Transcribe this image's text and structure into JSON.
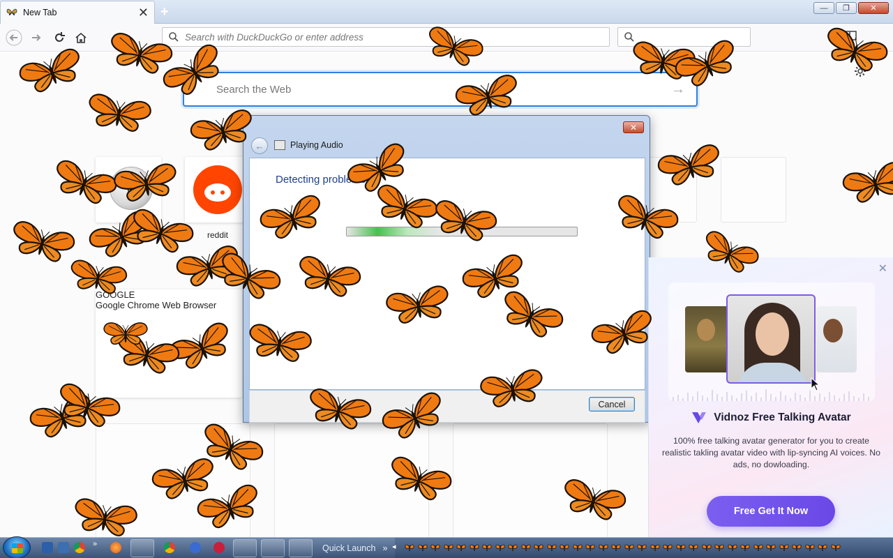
{
  "browser": {
    "tab_title": "New Tab",
    "tab_close": "✕",
    "new_tab": "+",
    "window_buttons": {
      "minimize": "—",
      "maximize": "❐",
      "close": "✕"
    },
    "url_placeholder": "Search with DuckDuckGo or enter address",
    "search_placeholder": ""
  },
  "newtab": {
    "search_placeholder": "Search the Web",
    "search_arrow": "→",
    "settings_icon": "gear-icon",
    "tiles": [
      {
        "label": "",
        "icon": "wikipedia-icon",
        "logo_text": "W"
      },
      {
        "label": "reddit",
        "icon": "reddit-icon"
      }
    ],
    "highlight": {
      "source": "GOOGLE",
      "title": "Google Chrome Web Browser"
    }
  },
  "dialog": {
    "title": "Playing Audio",
    "heading": "Detecting problems",
    "progress": 0.4,
    "cancel_label": "Cancel",
    "close_label": "✕",
    "back_label": "←"
  },
  "ad": {
    "close_label": "✕",
    "brand_name": "Vidnoz Free Talking Avatar",
    "description": "100% free talking avatar generator for you to create realistic takling avatar video with lip-syncing AI voices. No ads, no dowloading.",
    "cta_label": "Free Get It Now",
    "accent": "#6a48e6"
  },
  "taskbar": {
    "quick_launch_label": "Quick Launch",
    "chevron": "»",
    "tray_arrow": "◂"
  },
  "colors": {
    "butterfly_orange": "#f07a12",
    "butterfly_black": "#1a1208",
    "focus_blue": "#2d7fe0"
  }
}
